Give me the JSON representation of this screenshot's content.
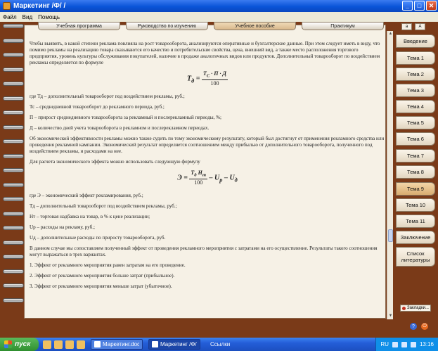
{
  "window": {
    "title": "Маркетинг /Ф/ /"
  },
  "menu": [
    "Файл",
    "Вид",
    "Помощь"
  ],
  "top_tabs": [
    {
      "label": "Учебная программа"
    },
    {
      "label": "Руководство по изучению"
    },
    {
      "label": "Учебное пособие"
    },
    {
      "label": "Практикум"
    }
  ],
  "font_buttons": [
    "a",
    "A"
  ],
  "side_tabs": [
    {
      "label": "Введение"
    },
    {
      "label": "Тема 1"
    },
    {
      "label": "Тема 2"
    },
    {
      "label": "Тема 3"
    },
    {
      "label": "Тема 4"
    },
    {
      "label": "Тема 5"
    },
    {
      "label": "Тема 6"
    },
    {
      "label": "Тема 7"
    },
    {
      "label": "Тема 8"
    },
    {
      "label": "Тема 9"
    },
    {
      "label": "Тема 10"
    },
    {
      "label": "Тема 11"
    },
    {
      "label": "Заключение"
    },
    {
      "label": "Список литературы"
    }
  ],
  "active_side_tab": "Тема 9",
  "bookmark": "Закладки...",
  "content": {
    "p1": "Чтобы выявить, в какой степени реклама повлияла на рост товарооборота, анализируются оперативные и бухгалтерские данные. При этом следует иметь в виду, что помимо рекламы на реализацию товара сказываются его качество и потребительские свойства, цена, внешний вид, а также место расположения торгового предприятия, уровень культуры обслуживания покупателей, наличие в продаже аналогичных видов или продуктов. Дополнительный товарооборот по воздействием рекламы определяется по формуле",
    "f1_lhs": "Т",
    "f1_lhs_sub": "д",
    "f1_num": "Т",
    "f1_num_sub": "С",
    "f1_num_rest": "· П · Д",
    "f1_den": "100",
    "d1": "где Тд – дополнительный товарооборот под воздействием рекламы, руб.;",
    "d2": "Тс – среднедневной товарооборот до рекламного периода, руб.;",
    "d3": "П – прирост среднедневного товарооборота за рекламный и послерекламный периоды, %;",
    "d4": "Д – количество дней учета товарооборота в рекламном и послерекламном периодах.",
    "p2": "Об экономической эффективности рекламы можно также судить по тому экономическому результату, который был достигнут от применения рекламного средства или проведения рекламной кампании. Экономический результат определяется соотношением между прибылью от дополнительного товарооборота, полученного под воздействием рекламы, и расходами на нее.",
    "p3": "Для расчета экономического эффекта можно использовать следующую формулу",
    "f2_lhs": "Э =",
    "f2_num": "Т",
    "f2_num_sub": "д",
    "f2_num_h": "Н",
    "f2_num_h_sub": "т",
    "f2_den": "100",
    "f2_rest": "– U",
    "f2_rest_sub": "р",
    "f2_rest2": "– U",
    "f2_rest2_sub": "д",
    "e1": "где Э – экономический эффект рекламирования, руб.;",
    "e2": "Тд – дополнительный товарооборот под воздействием рекламы, руб.;",
    "e3": "Нт – торговая надбавка на товар, в % к цене реализации;",
    "e4": "Uр – расходы на рекламу, руб.;",
    "e5": "Uд – дополнительные расходы по приросту товарооборота, руб.",
    "p4": "В данном случае мы сопоставляем полученный эффект от проведения рекламного мероприятия с затратами на его осуществление. Результаты такого соотношения могут выражаться в трех вариантах.",
    "l1": "1.    Эффект от рекламного мероприятия равен затратам на его проведение.",
    "l2": "2.    Эффект от рекламного мероприятия больше затрат (прибыльное).",
    "l3": "3.    Эффект от рекламного мероприятия меньше затрат (убыточное)."
  },
  "taskbar": {
    "start": "пуск",
    "task1": "Маркетинг.doc...",
    "task2": "Маркетинг /Ф/ /",
    "links": "Ссылки",
    "lang": "RU",
    "time": "13:16"
  }
}
